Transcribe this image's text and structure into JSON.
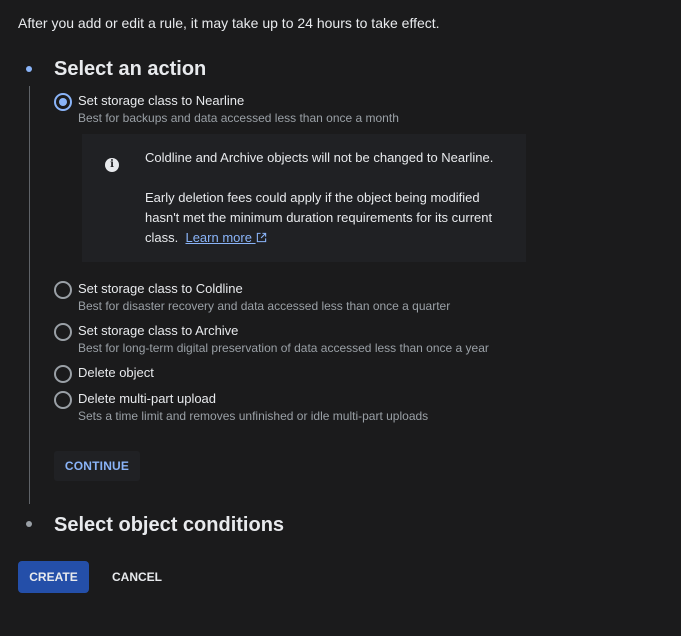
{
  "notice": "After you add or edit a rule, it may take up to 24 hours to take effect.",
  "steps": [
    {
      "title": "Select an action",
      "state": "active"
    },
    {
      "title": "Select object conditions",
      "state": "inactive"
    }
  ],
  "options": [
    {
      "label": "Set storage class to Nearline",
      "description": "Best for backups and data accessed less than once a month",
      "checked": true
    },
    {
      "label": "Set storage class to Coldline",
      "description": "Best for disaster recovery and data accessed less than once a quarter",
      "checked": false
    },
    {
      "label": "Set storage class to Archive",
      "description": "Best for long-term digital preservation of data accessed less than once a year",
      "checked": false
    },
    {
      "label": "Delete object",
      "description": "",
      "checked": false
    },
    {
      "label": "Delete multi-part upload",
      "description": "Sets a time limit and removes unfinished or idle multi-part uploads",
      "checked": false
    }
  ],
  "info": {
    "line1": "Coldline and Archive objects will not be changed to Nearline.",
    "line2": "Early deletion fees could apply if the object being modified",
    "line3": "hasn't met the minimum duration requirements for its current",
    "line4_prefix": "class.",
    "link_label": "Learn more"
  },
  "buttons": {
    "continue": "CONTINUE",
    "create": "CREATE",
    "cancel": "CANCEL"
  },
  "colors": {
    "accent": "#8ab4f8",
    "primary_button": "#244fa9",
    "background": "#1b1b1c"
  }
}
